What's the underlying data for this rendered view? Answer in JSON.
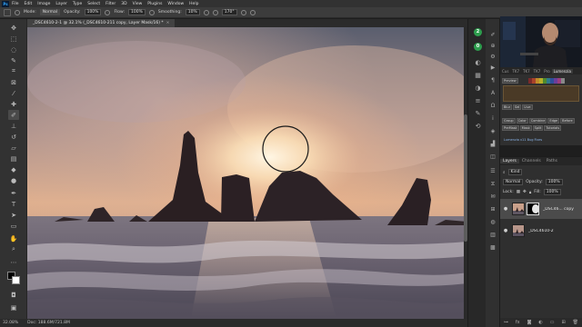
{
  "menubar": {
    "logo": "Ps",
    "items": [
      "File",
      "Edit",
      "Image",
      "Layer",
      "Type",
      "Select",
      "Filter",
      "3D",
      "View",
      "Plugins",
      "Window",
      "Help"
    ]
  },
  "options": {
    "mode_label": "Mode:",
    "mode_value": "Normal",
    "opacity_label": "Opacity:",
    "opacity_value": "100%",
    "flow_label": "Flow:",
    "flow_value": "100%",
    "smoothing_label": "Smoothing:",
    "smoothing_value": "10%",
    "angle_value": "170°"
  },
  "document": {
    "tab_title": "_DSC4610-2-1 @ 32.1% (_DSC4610-211 copy, Layer Mask/16) *",
    "close_glyph": "×"
  },
  "status": {
    "zoom": "32.08%",
    "doc_size": "Doc: 188.6M/721.8M"
  },
  "lumenzia": {
    "tabs": [
      "Cus",
      "TK7",
      "TK7",
      "TK7",
      "Pro",
      "Lumenzia"
    ],
    "active_tab": "Lumenzia",
    "preview_label": "Preview",
    "row_a": [
      "Blur",
      "Sel",
      "Live"
    ],
    "row_b": [
      "Group",
      "Color",
      "Combine",
      "Edge",
      "Before"
    ],
    "row_c": [
      "PreMask",
      "Mask",
      "Split",
      "Tutorials"
    ],
    "link_text": "Lumenzia v11 Bug Fixes",
    "swatch_colors": [
      "#7a2a2a",
      "#a8432a",
      "#c08a2a",
      "#b8b028",
      "#4f8a2e",
      "#2e7a8a",
      "#2e4f9a",
      "#6a3e9a",
      "#9a3e7e",
      "#888888"
    ]
  },
  "layers": {
    "tabs": [
      "Layers",
      "Channels",
      "Paths"
    ],
    "active_tab": "Layers",
    "filter_kind": "Kind",
    "blend_mode": "Normal",
    "opacity_label": "Opacity:",
    "opacity_value": "100%",
    "lock_label": "Lock:",
    "fill_label": "Fill:",
    "fill_value": "100%",
    "items": [
      {
        "name": "_DSC46... copy",
        "selected": true
      },
      {
        "name": "_DSC4610-2",
        "selected": false
      }
    ],
    "eye_glyph": "●"
  },
  "toolbar_icons": [
    "move-icon",
    "marquee-icon",
    "lasso-icon",
    "quick-select-icon",
    "crop-icon",
    "frame-icon",
    "eyedropper-icon",
    "healing-brush-icon",
    "brush-icon",
    "clone-stamp-icon",
    "history-brush-icon",
    "eraser-icon",
    "gradient-icon",
    "blur-icon",
    "dodge-icon",
    "pen-icon",
    "type-icon",
    "path-select-icon",
    "rectangle-icon",
    "hand-icon",
    "zoom-icon"
  ],
  "colors": {
    "accent": "#31a8ff",
    "panel_bg": "#2f2f2f",
    "app_bg": "#1e1e1e",
    "badge_green": "#2e9e4e"
  }
}
